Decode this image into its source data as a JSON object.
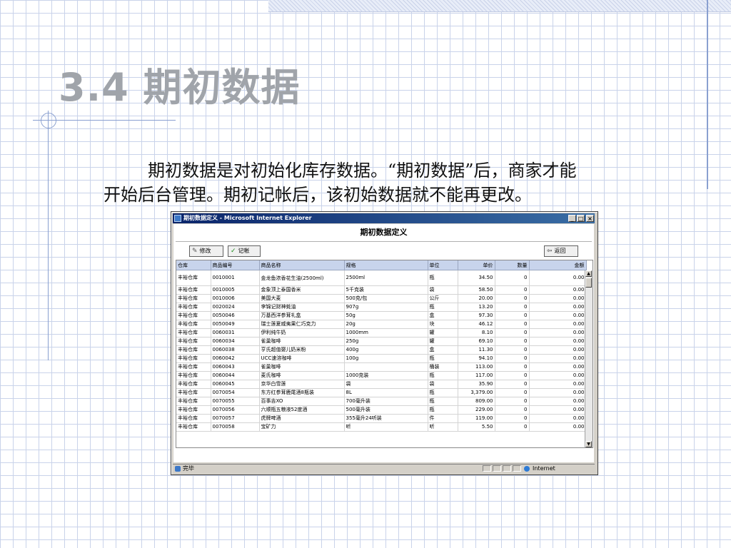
{
  "slide": {
    "title": "3.4 期初数据",
    "body_line1": "期初数据是对初始化库存数据。“期初数据”后，商家才能",
    "body_line2": "开始后台管理。期初记帐后，该初始数据就不能再更改。"
  },
  "window": {
    "title": "期初数据定义 - Microsoft Internet Explorer",
    "min_label": "_",
    "max_label": "□",
    "close_label": "×"
  },
  "form": {
    "title": "期初数据定义",
    "toolbar": {
      "edit_label": "修改",
      "post_label": "记帐",
      "back_label": "返回"
    }
  },
  "grid": {
    "headers": [
      "仓库",
      "商品编号",
      "商品名称",
      "规格",
      "单位",
      "单价",
      "数量",
      "金额"
    ],
    "rows": [
      [
        "丰裕仓库",
        "0010001",
        "金龙鱼浓香花生油(2500ml)",
        "2500ml",
        "瓶",
        "34.50",
        "0",
        "0.00"
      ],
      [
        "丰裕仓库",
        "0010005",
        "金象顶上泰国香米",
        "5千克装",
        "袋",
        "58.50",
        "0",
        "0.00"
      ],
      [
        "丰裕仓库",
        "0010006",
        "美国大麦",
        "500克/包",
        "公斤",
        "20.00",
        "0",
        "0.00"
      ],
      [
        "丰裕仓库",
        "0020024",
        "李锦记财神蚝油",
        "907g",
        "瓶",
        "13.20",
        "0",
        "0.00"
      ],
      [
        "丰裕仓库",
        "0050046",
        "万基西洋参茸礼盒",
        "50g",
        "盒",
        "97.30",
        "0",
        "0.00"
      ],
      [
        "丰裕仓库",
        "0050049",
        "瑞士莲夏威夷果仁巧克力",
        "20g",
        "块",
        "46.12",
        "0",
        "0.00"
      ],
      [
        "丰裕仓库",
        "0060031",
        "伊利纯牛奶",
        "1000mm",
        "罐",
        "8.10",
        "0",
        "0.00"
      ],
      [
        "丰裕仓库",
        "0060034",
        "雀巢咖啡",
        "250g",
        "罐",
        "69.10",
        "0",
        "0.00"
      ],
      [
        "丰裕仓库",
        "0060038",
        "亨氏超值婴儿奶米粉",
        "400g",
        "盒",
        "11.30",
        "0",
        "0.00"
      ],
      [
        "丰裕仓库",
        "0060042",
        "UCC速溶咖啡",
        "100g",
        "瓶",
        "94.10",
        "0",
        "0.00"
      ],
      [
        "丰裕仓库",
        "0060043",
        "雀巢咖啡",
        "",
        "桶装",
        "113.00",
        "0",
        "0.00"
      ],
      [
        "丰裕仓库",
        "0060044",
        "麦氏咖啡",
        "1000克装",
        "瓶",
        "117.00",
        "0",
        "0.00"
      ],
      [
        "丰裕仓库",
        "0060045",
        "京华白雪莲",
        "袋",
        "袋",
        "35.90",
        "0",
        "0.00"
      ],
      [
        "丰裕仓库",
        "0070054",
        "东方红参茸鹿尾酒8瓶装",
        "8L",
        "瓶",
        "3,379.00",
        "0",
        "0.00"
      ],
      [
        "丰裕仓库",
        "0070055",
        "百事吉XO",
        "700毫升装",
        "瓶",
        "809.00",
        "0",
        "0.00"
      ],
      [
        "丰裕仓库",
        "0070056",
        "六顺瓶五粮液52度酒",
        "500毫升装",
        "瓶",
        "229.00",
        "0",
        "0.00"
      ],
      [
        "丰裕仓库",
        "0070057",
        "虎牌啤酒",
        "355毫升24听装",
        "件",
        "119.00",
        "0",
        "0.00"
      ],
      [
        "丰裕仓库",
        "0070058",
        "宝矿力",
        "听",
        "听",
        "5.50",
        "0",
        "0.00"
      ]
    ]
  },
  "statusbar": {
    "status_text": "完毕",
    "zone_text": "Internet"
  },
  "colors": {
    "title_grey": "#a0a4aa",
    "ie_titlebar": "#0a246a",
    "grid_header": "#c8d4ec"
  }
}
